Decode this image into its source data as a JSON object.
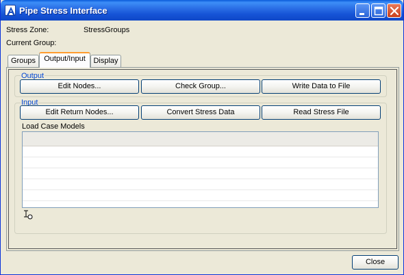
{
  "window": {
    "title": "Pipe Stress Interface"
  },
  "info": {
    "stress_zone_label": "Stress Zone:",
    "stress_zone_value": "StressGroups",
    "current_group_label": "Current Group:",
    "current_group_value": ""
  },
  "tabs": [
    {
      "label": "Groups",
      "active": false
    },
    {
      "label": "Output/Input",
      "active": true
    },
    {
      "label": "Display",
      "active": false
    }
  ],
  "output_group": {
    "label": "Output",
    "buttons": [
      "Edit Nodes...",
      "Check Group...",
      "Write Data to File"
    ]
  },
  "input_group": {
    "label": "Input",
    "buttons": [
      "Edit Return Nodes...",
      "Convert Stress Data",
      "Read Stress File"
    ],
    "load_case_label": "Load Case Models",
    "load_case_rows": [
      "",
      "",
      "",
      "",
      "",
      ""
    ]
  },
  "footer": {
    "close_label": "Close"
  },
  "colors": {
    "title_bar": "#2b6fe6",
    "window_bg": "#ece9d8",
    "group_label": "#0046d5",
    "active_tab_accent": "#ff9c2e"
  }
}
